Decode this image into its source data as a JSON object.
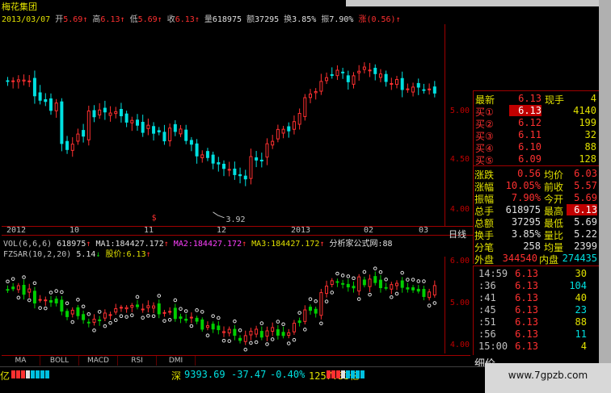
{
  "header": {
    "stock_name": "梅花集团",
    "date": "2013/03/07",
    "open_label": "开",
    "open": "5.69",
    "high_label": "高",
    "high": "6.13",
    "low_label": "低",
    "low": "5.69",
    "close_label": "收",
    "close": "6.13",
    "volume_label": "量",
    "volume": "618975",
    "amount_label": "额",
    "amount": "37295",
    "turnover_label": "换",
    "turnover": "3.85%",
    "amplitude_label": "振",
    "amplitude": "7.90%",
    "change_label": "涨",
    "change": "(0.56)",
    "up_arrow": "↑"
  },
  "price_axis": [
    "5.00",
    "4.50",
    "4.00"
  ],
  "date_axis": [
    {
      "label": "2012"
    },
    {
      "label": "10"
    },
    {
      "label": "11"
    },
    {
      "label": "12"
    },
    {
      "label": "2013"
    },
    {
      "label": "02"
    },
    {
      "label": "03"
    }
  ],
  "period_label": "日线",
  "chart_annotations": {
    "low_mark": "3.92",
    "event_mark": "$"
  },
  "vol_indicator": {
    "name": "VOL(6,6,6)",
    "value": "618975",
    "ma1": "MA1:184427.172",
    "ma2": "MA2:184427.172",
    "ma3": "MA3:184427.172",
    "note": "分析家公式网:88"
  },
  "sar_indicator": {
    "name": "FZSAR(10,2,20)",
    "value": "5.14",
    "down_arrow": "↓",
    "price_label": "股价:6.13"
  },
  "sar_axis": [
    "6.00",
    "5.00",
    "4.00"
  ],
  "tabs": [
    "MA",
    "BOLL",
    "MACD",
    "RSI",
    "DMI"
  ],
  "quote_panel": {
    "latest": {
      "label": "最新",
      "value": "6.13",
      "label2": "现手",
      "value2": "4"
    },
    "bids": [
      {
        "label": "买①",
        "price": "6.13",
        "vol": "4140"
      },
      {
        "label": "买②",
        "price": "6.12",
        "vol": "199"
      },
      {
        "label": "买③",
        "price": "6.11",
        "vol": "32"
      },
      {
        "label": "买④",
        "price": "6.10",
        "vol": "88"
      },
      {
        "label": "买⑤",
        "price": "6.09",
        "vol": "128"
      }
    ],
    "stats": [
      {
        "k1": "涨跌",
        "v1": "0.56",
        "k2": "均价",
        "v2": "6.03"
      },
      {
        "k1": "涨幅",
        "v1": "10.05%",
        "k2": "前收",
        "v2": "5.57"
      },
      {
        "k1": "振幅",
        "v1": "7.90%",
        "k2": "今开",
        "v2": "5.69"
      },
      {
        "k1": "总手",
        "v1": "618975",
        "k2": "最高",
        "v2": "6.13"
      },
      {
        "k1": "总额",
        "v1": "37295",
        "k2": "最低",
        "v2": "5.69"
      },
      {
        "k1": "换手",
        "v1": "3.85%",
        "k2": "量比",
        "v2": "5.22"
      },
      {
        "k1": "分笔",
        "v1": "258",
        "k2": "均量",
        "v2": "2399"
      }
    ],
    "outer": {
      "label": "外盘",
      "value": "344540",
      "label2": "内盘",
      "value2": "274435"
    }
  },
  "trades": [
    {
      "time": "14:59",
      "price": "6.13",
      "qty": "30"
    },
    {
      "time": ":36",
      "price": "6.13",
      "qty": "104"
    },
    {
      "time": ":41",
      "price": "6.13",
      "qty": "40"
    },
    {
      "time": ":45",
      "price": "6.13",
      "qty": "23"
    },
    {
      "time": ":51",
      "price": "6.13",
      "qty": "88"
    },
    {
      "time": ":56",
      "price": "6.13",
      "qty": "11"
    },
    {
      "time": "15:00",
      "price": "6.13",
      "qty": "4"
    }
  ],
  "detail_label": "细价",
  "statusbar": {
    "left_unit": "亿",
    "market": "深",
    "index": "9393.69",
    "change": "-37.47",
    "pct": "-0.40%",
    "amount": "1257.33亿"
  },
  "watermark": "www.7gpzb.com",
  "colors": {
    "up": "#ff3030",
    "down": "#00e0e0",
    "green": "#00d000",
    "yellow": "#e0e000",
    "axis_red": "#a00000"
  }
}
